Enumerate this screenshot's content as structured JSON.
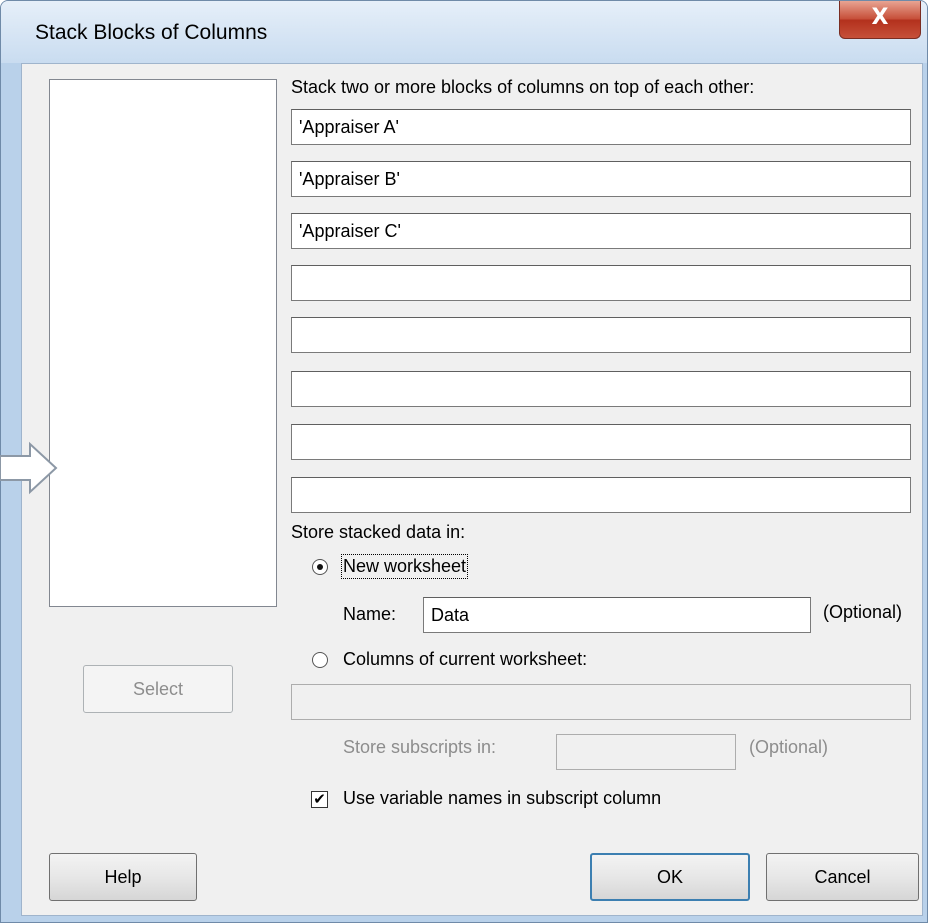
{
  "window": {
    "title": "Stack Blocks of Columns",
    "close_glyph": "X"
  },
  "main": {
    "instruction_label": "Stack two or more blocks of columns on top of each other:",
    "block_fields": [
      "'Appraiser A'",
      "'Appraiser B'",
      "'Appraiser C'",
      "",
      "",
      "",
      "",
      ""
    ],
    "select_button": "Select"
  },
  "store": {
    "label": "Store stacked data in:",
    "new_worksheet": {
      "label": "New worksheet",
      "selected": true
    },
    "name_label": "Name:",
    "name_value": "Data",
    "optional_1": "(Optional)",
    "columns_current": {
      "label": "Columns of current worksheet:",
      "selected": false
    },
    "columns_value": "",
    "subscripts_label": "Store subscripts in:",
    "subscripts_value": "",
    "optional_2": "(Optional)",
    "use_varnames": {
      "label": "Use variable names in subscript column",
      "checked": true
    }
  },
  "buttons": {
    "help": "Help",
    "ok": "OK",
    "cancel": "Cancel"
  },
  "icons": {
    "arrow": "right-arrow-icon",
    "check": "checkmark-icon"
  },
  "colors": {
    "frame": "#b9d1ea",
    "close": "#c7503a",
    "default_border": "#3c7fb1"
  }
}
